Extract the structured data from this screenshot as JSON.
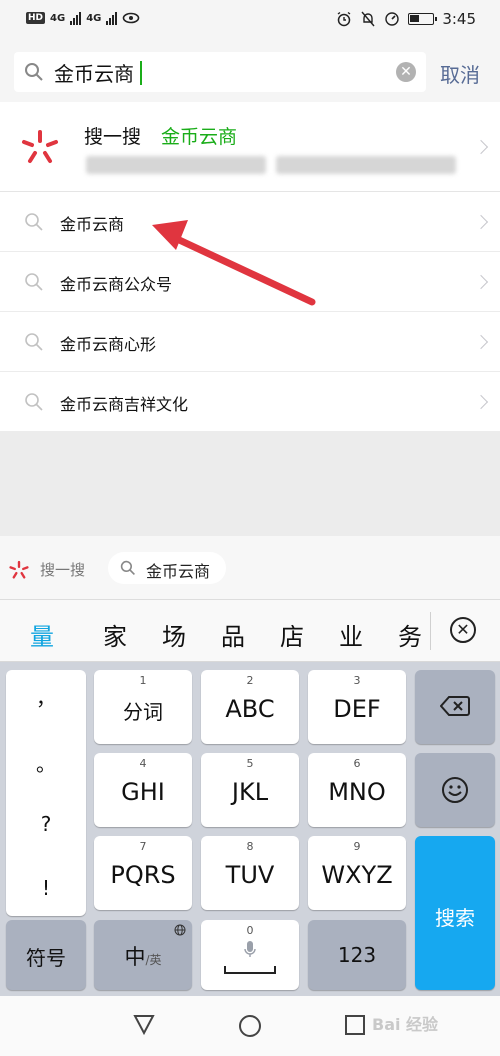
{
  "status_bar": {
    "network_badge": "HD",
    "net1": "4G",
    "net2": "4G",
    "time": "3:45",
    "battery_level": 0.45
  },
  "search": {
    "query": "金币云商",
    "cancel_label": "取消",
    "clear_icon": "clear-circle-icon"
  },
  "sousou_row": {
    "title": "搜一搜",
    "keyword": "金币云商"
  },
  "suggestions": [
    "金币云商",
    "金币云商公众号",
    "金币云商心形",
    "金币云商吉祥文化"
  ],
  "keyboard_strip": {
    "sousou_label": "搜一搜",
    "chip_text": "金币云商"
  },
  "candidates": [
    "量",
    "家",
    "场",
    "品",
    "店",
    "业",
    "务"
  ],
  "keyboard": {
    "punctuation": [
      "，",
      "。",
      "?",
      "!"
    ],
    "keys": {
      "k1": {
        "num": "1",
        "label": "分词"
      },
      "k2": {
        "num": "2",
        "label": "ABC"
      },
      "k3": {
        "num": "3",
        "label": "DEF"
      },
      "k4": {
        "num": "4",
        "label": "GHI"
      },
      "k5": {
        "num": "5",
        "label": "JKL"
      },
      "k6": {
        "num": "6",
        "label": "MNO"
      },
      "k7": {
        "num": "7",
        "label": "PQRS"
      },
      "k8": {
        "num": "8",
        "label": "TUV"
      },
      "k9": {
        "num": "9",
        "label": "WXYZ"
      },
      "k0": {
        "num": "0"
      }
    },
    "symbols_label": "符号",
    "lang_main": "中",
    "lang_alt": "/英",
    "numbers_label": "123",
    "search_label": "搜索"
  },
  "watermark": "Bai 经验",
  "colors": {
    "accent_green": "#1aad19",
    "link_blue": "#576b95",
    "keyboard_blue": "#16a8f0",
    "arrow_red": "#e0353f"
  }
}
